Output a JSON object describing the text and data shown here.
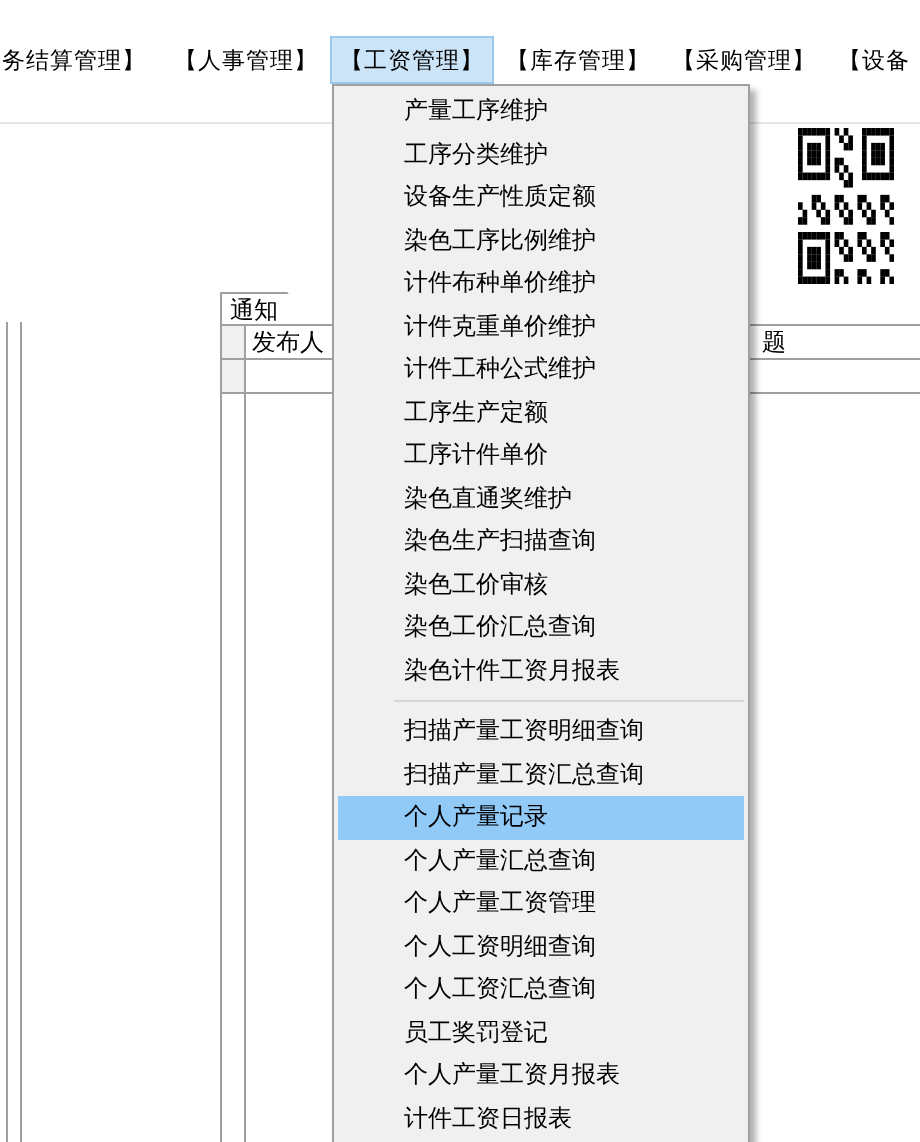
{
  "menubar": [
    {
      "label": "务结算管理】",
      "selected": false
    },
    {
      "label": "【人事管理】",
      "selected": false
    },
    {
      "label": "【工资管理】",
      "selected": true
    },
    {
      "label": "【库存管理】",
      "selected": false
    },
    {
      "label": "【采购管理】",
      "selected": false
    },
    {
      "label": "【设备",
      "selected": false
    }
  ],
  "dropdown": {
    "groups": [
      [
        {
          "label": "产量工序维护",
          "selected": false
        },
        {
          "label": "工序分类维护",
          "selected": false
        },
        {
          "label": "设备生产性质定额",
          "selected": false
        },
        {
          "label": "染色工序比例维护",
          "selected": false
        },
        {
          "label": "计件布种单价维护",
          "selected": false
        },
        {
          "label": "计件克重单价维护",
          "selected": false
        },
        {
          "label": "计件工种公式维护",
          "selected": false
        },
        {
          "label": "工序生产定额",
          "selected": false
        },
        {
          "label": "工序计件单价",
          "selected": false
        },
        {
          "label": "染色直通奖维护",
          "selected": false
        },
        {
          "label": "染色生产扫描查询",
          "selected": false
        },
        {
          "label": "染色工价审核",
          "selected": false
        },
        {
          "label": "染色工价汇总查询",
          "selected": false
        },
        {
          "label": "染色计件工资月报表",
          "selected": false
        }
      ],
      [
        {
          "label": "扫描产量工资明细查询",
          "selected": false
        },
        {
          "label": "扫描产量工资汇总查询",
          "selected": false
        },
        {
          "label": "个人产量记录",
          "selected": true
        },
        {
          "label": "个人产量汇总查询",
          "selected": false
        },
        {
          "label": "个人产量工资管理",
          "selected": false
        },
        {
          "label": "个人工资明细查询",
          "selected": false
        },
        {
          "label": "个人工资汇总查询",
          "selected": false
        },
        {
          "label": "员工奖罚登记",
          "selected": false
        },
        {
          "label": "个人产量工资月报表",
          "selected": false
        },
        {
          "label": "计件工资日报表",
          "selected": false
        }
      ]
    ]
  },
  "notice_panel": {
    "tab": "通知",
    "columns": [
      "发布人",
      "题"
    ]
  }
}
